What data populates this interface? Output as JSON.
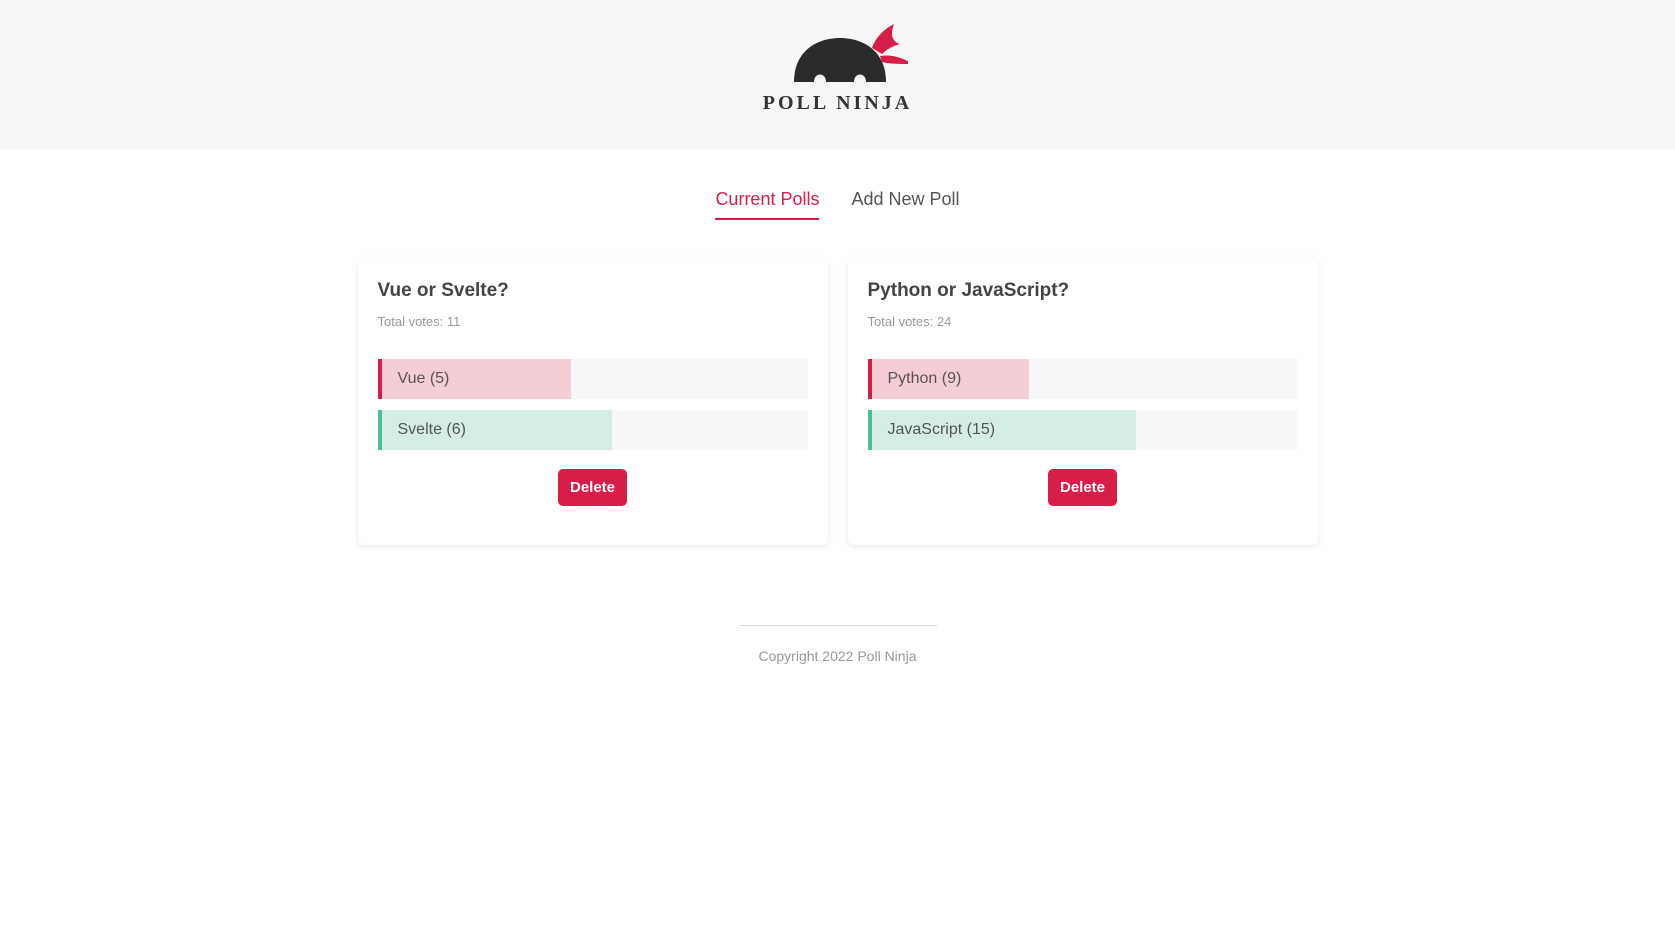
{
  "brand": {
    "name": "POLL NINJA"
  },
  "tabs": [
    {
      "label": "Current Polls",
      "active": true
    },
    {
      "label": "Add New Poll",
      "active": false
    }
  ],
  "polls": [
    {
      "question": "Vue or Svelte?",
      "total_label": "Total votes: 11",
      "answers": [
        {
          "label": "Vue (5)",
          "share": 0.45
        },
        {
          "label": "Svelte (6)",
          "share": 0.545
        }
      ],
      "delete_label": "Delete"
    },
    {
      "question": "Python or JavaScript?",
      "total_label": "Total votes: 24",
      "answers": [
        {
          "label": "Python (9)",
          "share": 0.375
        },
        {
          "label": "JavaScript (15)",
          "share": 0.625
        }
      ],
      "delete_label": "Delete"
    }
  ],
  "footer": {
    "copyright": "Copyright 2022 Poll Ninja"
  },
  "colors": {
    "accent": "#d81e48",
    "secondary": "#4cc09a",
    "header_bg": "#f7f7f7"
  }
}
